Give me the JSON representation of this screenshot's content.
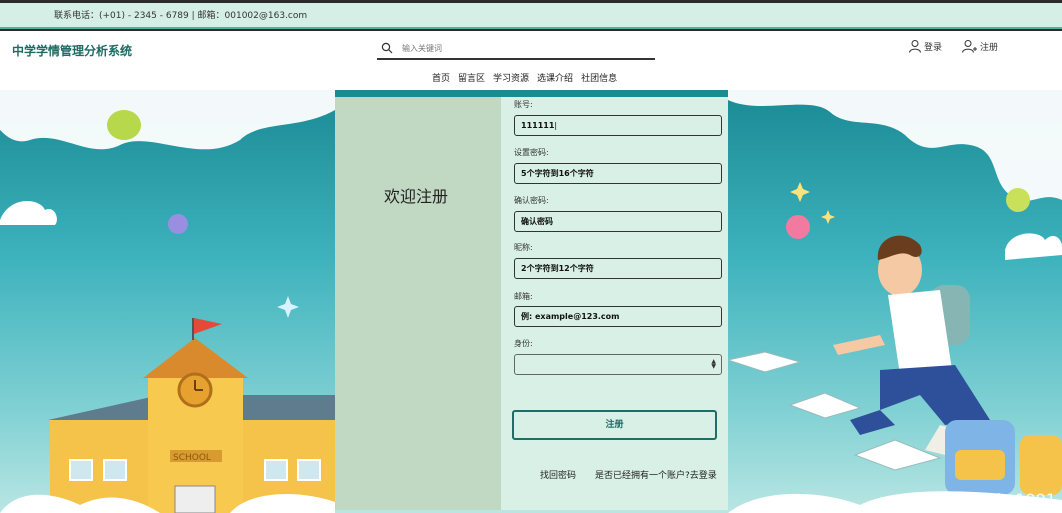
{
  "topbar": {
    "contact": "联系电话：(+01) - 2345 - 6789 | 邮箱：001002@163.com"
  },
  "header": {
    "logo": "中学学情管理分析系统",
    "search_placeholder": "输入关键词",
    "login": "登录",
    "register": "注册",
    "nav": [
      "首页",
      "留言区",
      "学习资源",
      "选课介绍",
      "社团信息"
    ]
  },
  "form": {
    "welcome": "欢迎注册",
    "account_label": "账号:",
    "account_value": "111111",
    "password_label": "设置密码:",
    "password_placeholder": "5个字符到16个字符",
    "confirm_label": "确认密码:",
    "confirm_placeholder": "确认密码",
    "nickname_label": "昵称:",
    "nickname_placeholder": "2个字符到12个字符",
    "email_label": "邮箱:",
    "email_placeholder": "例: example@123.com",
    "identity_label": "身份:",
    "identity_value": "",
    "submit": "注册",
    "find_password": "找回密码",
    "have_account": "是否已经拥有一个账户?去登录"
  },
  "scene": {
    "school_sign": "SCHOOL"
  },
  "watermark": "CSDN @kybs1991",
  "colors": {
    "accent": "#1e6d69",
    "topbar_bg": "#d6efe6",
    "panel_left": "#c1d8c3",
    "panel_right": "#d9f0e6"
  }
}
